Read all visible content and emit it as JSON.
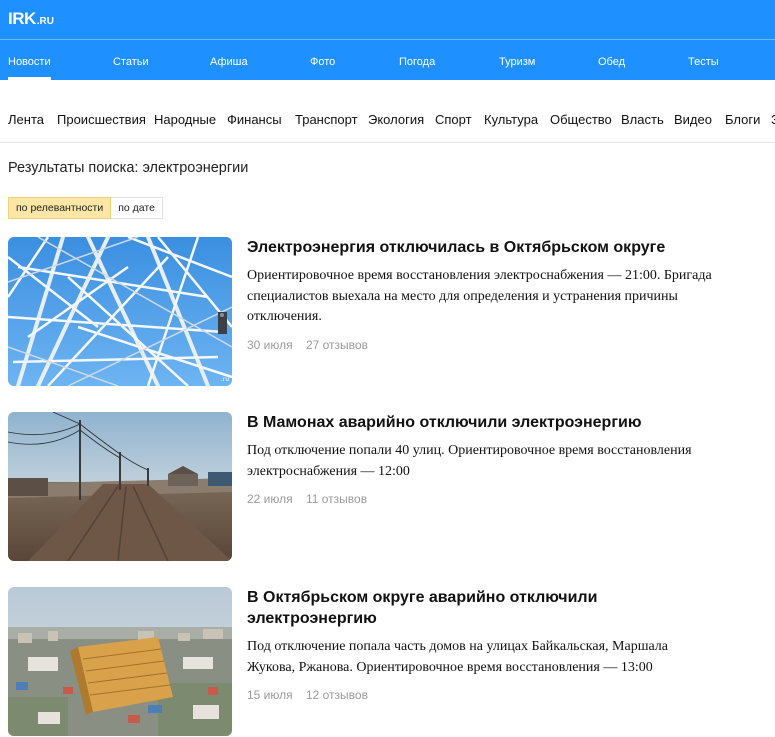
{
  "logo": {
    "main": "IRK",
    "tld": ".RU"
  },
  "main_nav": [
    "Новости",
    "Статьи",
    "Афиша",
    "Фото",
    "Погода",
    "Туризм",
    "Обед",
    "Тесты"
  ],
  "sub_nav": [
    "Лента",
    "Происшествия",
    "Народные",
    "Финансы",
    "Транспорт",
    "Экология",
    "Спорт",
    "Культура",
    "Общество",
    "Власть",
    "Видео",
    "Блоги",
    "З"
  ],
  "search": {
    "title": "Результаты поиска: электроэнергии"
  },
  "sort": {
    "relevance": "по релевантности",
    "date": "по дате"
  },
  "articles": [
    {
      "title": "Электроэнергия отключилась в Октябрьском округе",
      "lead": "Ориентировочное время восстановления электроснабжения — 21:00. Бригада специалистов выехала на место для определения и устранения причины отключения.",
      "date": "30 июля",
      "reviews": "27 отзывов"
    },
    {
      "title": "В Мамонах аварийно отключили электроэнергию",
      "lead": "Под отключение попали 40 улиц. Ориентировочное время восстановления электроснабжения — 12:00",
      "date": "22 июля",
      "reviews": "11 отзывов"
    },
    {
      "title": "В Октябрьском округе аварийно отключили электроэнергию",
      "lead": "Под отключение попала часть домов на улицах Байкальская, Маршала Жукова, Ржанова. Ориентировочное время восстановления — 13:00",
      "date": "15 июля",
      "reviews": "12 отзывов"
    }
  ],
  "colors": {
    "header_bg": "#1e90ff",
    "sort_active_bg": "#fbe6a5",
    "meta_text": "#9a9a9a"
  }
}
